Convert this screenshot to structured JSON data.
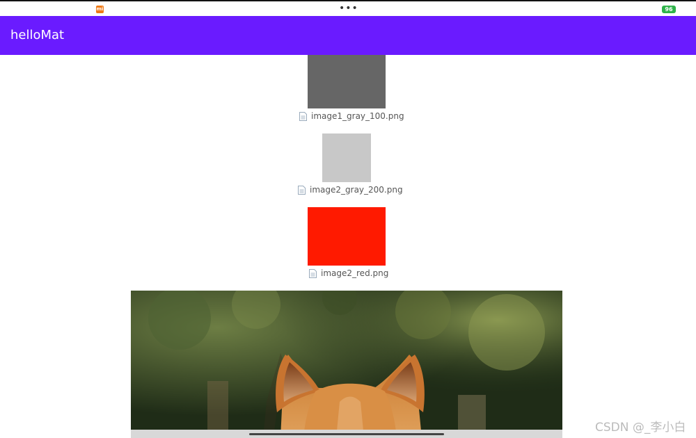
{
  "status_bar": {
    "mi_badge": "mi",
    "center_dots": "•••",
    "battery_level": "96",
    "colors": {
      "mi_badge": "#f07a16",
      "battery": "#2fb34a"
    }
  },
  "app_bar": {
    "title": "helloMat",
    "color": "#6a1bff"
  },
  "images": [
    {
      "file_name": "image1_gray_100.png",
      "color": "#666666"
    },
    {
      "file_name": "image2_gray_200.png",
      "color": "#c8c8c8"
    },
    {
      "file_name": "image2_red.png",
      "color": "#ff1a00"
    }
  ],
  "photo": {
    "subject": "dog-photo"
  },
  "watermark": "CSDN @_李小白"
}
